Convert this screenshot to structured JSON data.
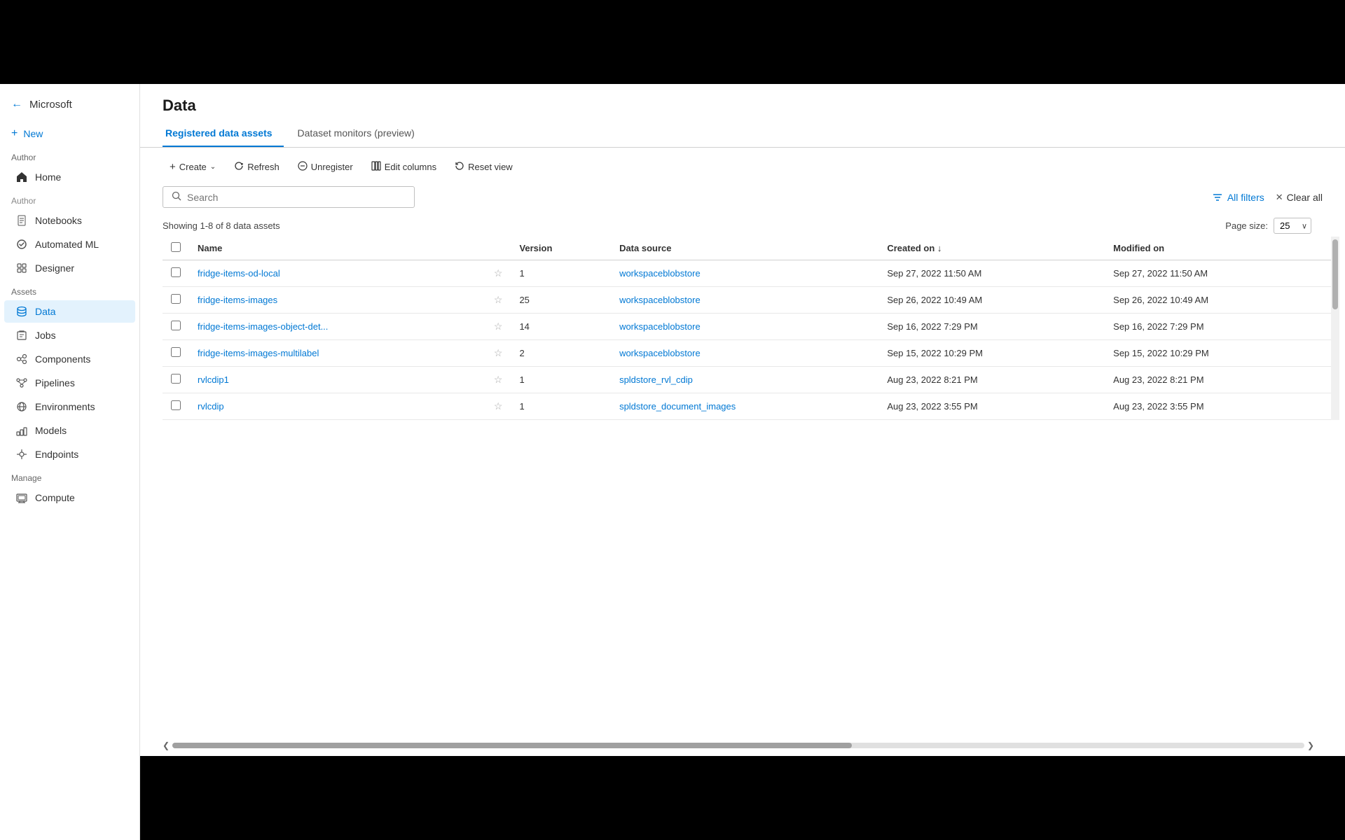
{
  "page": {
    "title": "Data"
  },
  "sidebar": {
    "brand": "Microsoft",
    "back_icon": "←",
    "new_label": "New",
    "author_label": "Author",
    "assets_label": "Assets",
    "manage_label": "Manage",
    "items": [
      {
        "id": "home",
        "label": "Home",
        "icon": "⌂",
        "active": false
      },
      {
        "id": "notebooks",
        "label": "Notebooks",
        "icon": "📓",
        "active": false
      },
      {
        "id": "automated-ml",
        "label": "Automated ML",
        "icon": "⚙",
        "active": false
      },
      {
        "id": "designer",
        "label": "Designer",
        "icon": "🎨",
        "active": false
      },
      {
        "id": "data",
        "label": "Data",
        "icon": "📊",
        "active": true
      },
      {
        "id": "jobs",
        "label": "Jobs",
        "icon": "📋",
        "active": false
      },
      {
        "id": "components",
        "label": "Components",
        "icon": "🧩",
        "active": false
      },
      {
        "id": "pipelines",
        "label": "Pipelines",
        "icon": "🔀",
        "active": false
      },
      {
        "id": "environments",
        "label": "Environments",
        "icon": "🌐",
        "active": false
      },
      {
        "id": "models",
        "label": "Models",
        "icon": "🤖",
        "active": false
      },
      {
        "id": "endpoints",
        "label": "Endpoints",
        "icon": "🔗",
        "active": false
      },
      {
        "id": "compute",
        "label": "Compute",
        "icon": "💻",
        "active": false
      }
    ]
  },
  "tabs": [
    {
      "id": "registered",
      "label": "Registered data assets",
      "active": true
    },
    {
      "id": "monitors",
      "label": "Dataset monitors (preview)",
      "active": false
    }
  ],
  "toolbar": {
    "create_label": "Create",
    "refresh_label": "Refresh",
    "unregister_label": "Unregister",
    "edit_columns_label": "Edit columns",
    "reset_view_label": "Reset view"
  },
  "search": {
    "placeholder": "Search",
    "value": ""
  },
  "filters": {
    "all_filters_label": "All filters",
    "clear_all_label": "Clear all"
  },
  "table": {
    "showing_text": "Showing 1-8 of 8 data assets",
    "page_size_label": "Page size:",
    "page_size_value": "25",
    "columns": [
      {
        "id": "name",
        "label": "Name"
      },
      {
        "id": "star",
        "label": ""
      },
      {
        "id": "version",
        "label": "Version"
      },
      {
        "id": "datasource",
        "label": "Data source"
      },
      {
        "id": "created_on",
        "label": "Created on ↓"
      },
      {
        "id": "modified_on",
        "label": "Modified on"
      }
    ],
    "rows": [
      {
        "name": "fridge-items-od-local",
        "version": "1",
        "datasource": "workspaceblobstore",
        "created_on": "Sep 27, 2022 11:50 AM",
        "modified_on": "Sep 27, 2022 11:50 AM"
      },
      {
        "name": "fridge-items-images",
        "version": "25",
        "datasource": "workspaceblobstore",
        "created_on": "Sep 26, 2022 10:49 AM",
        "modified_on": "Sep 26, 2022 10:49 AM"
      },
      {
        "name": "fridge-items-images-object-det...",
        "version": "14",
        "datasource": "workspaceblobstore",
        "created_on": "Sep 16, 2022 7:29 PM",
        "modified_on": "Sep 16, 2022 7:29 PM"
      },
      {
        "name": "fridge-items-images-multilabel",
        "version": "2",
        "datasource": "workspaceblobstore",
        "created_on": "Sep 15, 2022 10:29 PM",
        "modified_on": "Sep 15, 2022 10:29 PM"
      },
      {
        "name": "rvlcdip1",
        "version": "1",
        "datasource": "spldstore_rvl_cdip",
        "created_on": "Aug 23, 2022 8:21 PM",
        "modified_on": "Aug 23, 2022 8:21 PM"
      },
      {
        "name": "rvlcdip",
        "version": "1",
        "datasource": "spldstore_document_images",
        "created_on": "Aug 23, 2022 3:55 PM",
        "modified_on": "Aug 23, 2022 3:55 PM"
      }
    ]
  },
  "colors": {
    "active_tab": "#0078d4",
    "link": "#0078d4",
    "active_sidebar_bg": "#e3f2fd"
  }
}
